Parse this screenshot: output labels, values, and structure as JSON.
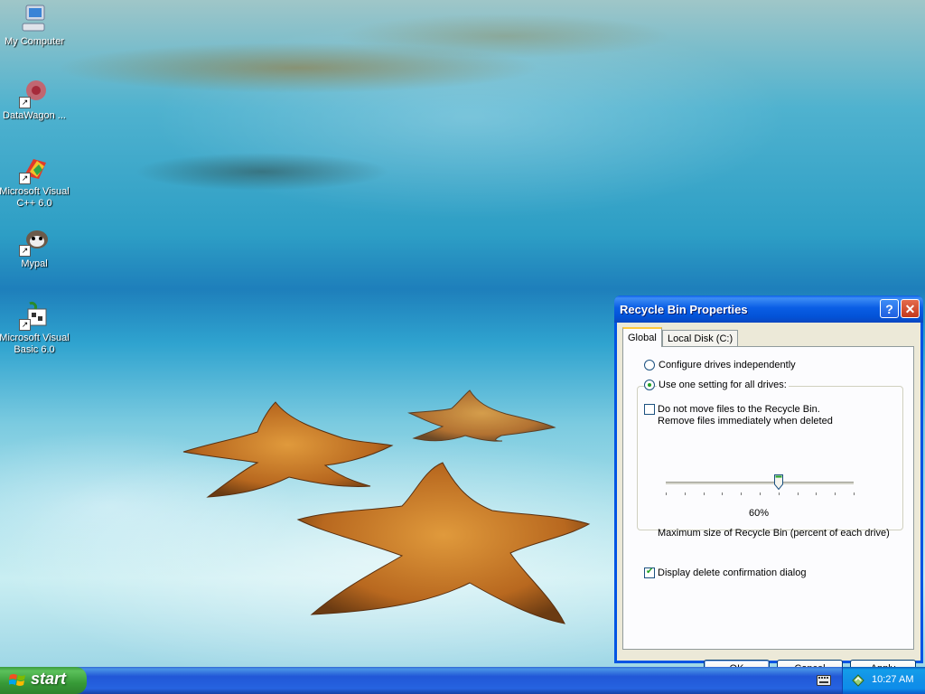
{
  "desktop": {
    "icons": [
      {
        "label": "My Computer",
        "icon": "computer-icon"
      },
      {
        "label": "DataWagon ...",
        "icon": "datawagon-shortcut-icon"
      },
      {
        "label": "Microsoft Visual C++ 6.0",
        "icon": "visual-cpp-shortcut-icon"
      },
      {
        "label": "Mypal",
        "icon": "mypal-shortcut-icon"
      },
      {
        "label": "Microsoft Visual Basic 6.0",
        "icon": "visual-basic-shortcut-icon"
      }
    ]
  },
  "dialog": {
    "title": "Recycle Bin Properties",
    "help_glyph": "?",
    "close_glyph": "✕",
    "tabs": [
      {
        "label": "Global",
        "selected": true
      },
      {
        "label": "Local Disk (C:)",
        "selected": false
      }
    ],
    "options": {
      "configure_independently": {
        "label": "Configure drives independently",
        "selected": false
      },
      "one_setting": {
        "label": "Use one setting for all drives:",
        "selected": true
      },
      "do_not_move": {
        "line1": "Do not move files to the Recycle Bin.",
        "line2": "Remove files immediately when deleted",
        "checked": false
      },
      "slider": {
        "value_label": "60%",
        "value": 0.6,
        "caption": "Maximum size of Recycle Bin (percent of each drive)"
      },
      "confirm_dialog": {
        "label": "Display delete confirmation dialog",
        "checked": true
      }
    },
    "buttons": {
      "ok": "OK",
      "cancel": "Cancel",
      "apply": "Apply"
    }
  },
  "taskbar": {
    "start_label": "start",
    "clock": "10:27 AM"
  },
  "colors": {
    "title_bar": "#0054e3",
    "start_button": "#3c9b3c",
    "dialog_face": "#ece9d8"
  }
}
